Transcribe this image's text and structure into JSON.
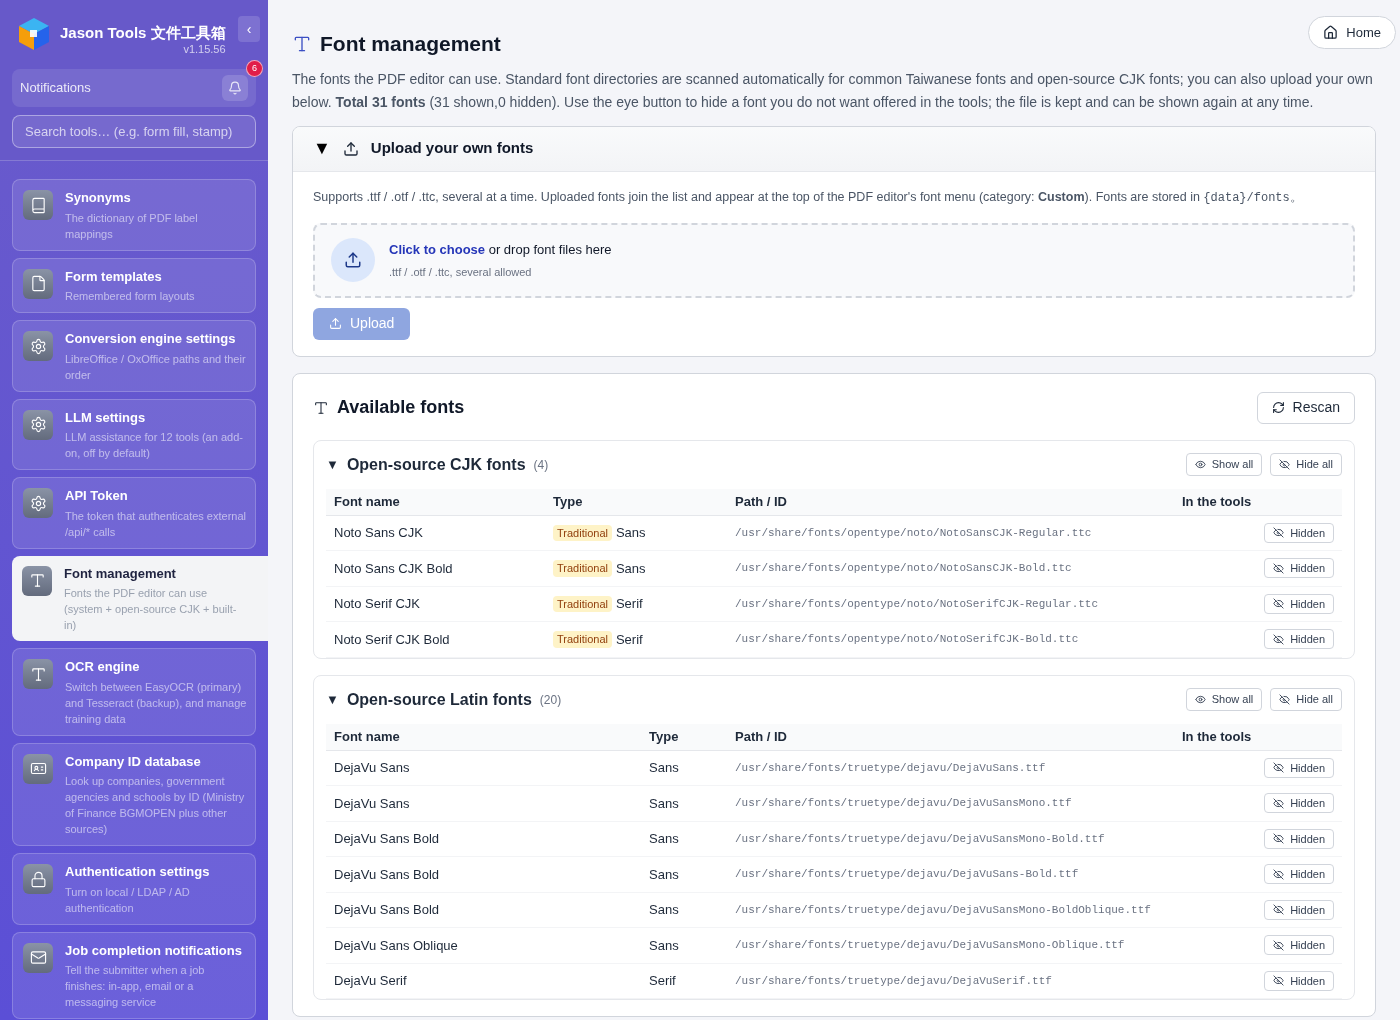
{
  "sidebar": {
    "app_title": "Jason Tools 文件工具箱",
    "version": "v1.15.56",
    "collapse": "‹",
    "notifications": {
      "label": "Notifications",
      "count": "6"
    },
    "search": {
      "placeholder": "Search tools… (e.g. form fill, stamp)"
    },
    "items": [
      {
        "kind": "book",
        "title": "Synonyms",
        "description": "The dictionary of PDF label mappings",
        "selected": false
      },
      {
        "kind": "file",
        "title": "Form templates",
        "description": "Remembered form layouts",
        "selected": false
      },
      {
        "kind": "gear",
        "title": "Conversion engine settings",
        "description": "LibreOffice / OxOffice paths and their order",
        "selected": false
      },
      {
        "kind": "gear",
        "title": "LLM settings",
        "description": "LLM assistance for 12 tools (an add-on, off by default)",
        "selected": false
      },
      {
        "kind": "gear",
        "title": "API Token",
        "description": "The token that authenticates external /api/* calls",
        "selected": false
      },
      {
        "kind": "type",
        "title": "Font management",
        "description": "Fonts the PDF editor can use (system + open-source CJK + built-in)",
        "selected": true
      },
      {
        "kind": "type",
        "title": "OCR engine",
        "description": "Switch between EasyOCR (primary) and Tesseract (backup), and manage training data",
        "selected": false
      },
      {
        "kind": "idcard",
        "title": "Company ID database",
        "description": "Look up companies, government agencies and schools by ID (Ministry of Finance BGMOPEN plus other sources)",
        "selected": false
      },
      {
        "kind": "lock",
        "title": "Authentication settings",
        "description": "Turn on local / LDAP / AD authentication",
        "selected": false
      },
      {
        "kind": "mail",
        "title": "Job completion notifications",
        "description": "Tell the submitter when a job finishes: in-app, email or a messaging service",
        "selected": false
      }
    ]
  },
  "page": {
    "title": "Font management",
    "home": "Home",
    "intro": "The fonts the PDF editor can use. Standard font directories are scanned automatically for common Taiwanese fonts and open-source CJK fonts; you can also upload your own below. **Total 31 fonts** (31 shown,0 hidden). Use the eye button to hide a font you do not want offered in the tools; the file is kept and can be shown again at any time."
  },
  "upload": {
    "expander": "▼",
    "title": "Upload your own fonts",
    "expanded": true,
    "note": "Supports .ttf / .otf / .ttc, several at a time. Uploaded fonts join the list and appear at the top of the PDF editor's font menu (category: **Custom**). Fonts are stored in ",
    "note_code": "{data}/fonts",
    "note_end": "。",
    "drop_link": "Click to choose",
    "drop_text": "or drop font files here",
    "drop_hint": ".ttf / .otf / .ttc, several allowed",
    "button": "Upload",
    "button_disabled": true
  },
  "available": {
    "title": "Available fonts",
    "rescan": "Rescan",
    "groups": [
      {
        "kind": "cjk",
        "expander": "▼",
        "title": "Open-source CJK fonts",
        "count": "(4)",
        "show_all": "Show all",
        "hide_all": "Hide all",
        "columns": [
          "Font name",
          "Type",
          "Path / ID",
          "In the tools"
        ],
        "rows": [
          {
            "name": "Noto Sans CJK",
            "tag": "Traditional",
            "type": "Sans",
            "path": "/usr/share/fonts/opentype/noto/NotoSansCJK-Regular.ttc",
            "status": "Hidden",
            "visible": false
          },
          {
            "name": "Noto Sans CJK Bold",
            "tag": "Traditional",
            "type": "Sans",
            "path": "/usr/share/fonts/opentype/noto/NotoSansCJK-Bold.ttc",
            "status": "Hidden",
            "visible": false
          },
          {
            "name": "Noto Serif CJK",
            "tag": "Traditional",
            "type": "Serif",
            "path": "/usr/share/fonts/opentype/noto/NotoSerifCJK-Regular.ttc",
            "status": "Hidden",
            "visible": false
          },
          {
            "name": "Noto Serif CJK Bold",
            "tag": "Traditional",
            "type": "Serif",
            "path": "/usr/share/fonts/opentype/noto/NotoSerifCJK-Bold.ttc",
            "status": "Hidden",
            "visible": false
          }
        ]
      },
      {
        "kind": "latin",
        "expander": "▼",
        "title": "Open-source Latin fonts",
        "count": "(20)",
        "show_all": "Show all",
        "hide_all": "Hide all",
        "columns": [
          "Font name",
          "Type",
          "Path / ID",
          "In the tools"
        ],
        "rows": [
          {
            "name": "DejaVu Sans",
            "type": "Sans",
            "path": "/usr/share/fonts/truetype/dejavu/DejaVuSans.ttf",
            "status": "Hidden",
            "visible": false
          },
          {
            "name": "DejaVu Sans",
            "type": "Sans",
            "path": "/usr/share/fonts/truetype/dejavu/DejaVuSansMono.ttf",
            "status": "Hidden",
            "visible": false
          },
          {
            "name": "DejaVu Sans Bold",
            "type": "Sans",
            "path": "/usr/share/fonts/truetype/dejavu/DejaVuSansMono-Bold.ttf",
            "status": "Hidden",
            "visible": false
          },
          {
            "name": "DejaVu Sans Bold",
            "type": "Sans",
            "path": "/usr/share/fonts/truetype/dejavu/DejaVuSans-Bold.ttf",
            "status": "Hidden",
            "visible": false
          },
          {
            "name": "DejaVu Sans Bold",
            "type": "Sans",
            "path": "/usr/share/fonts/truetype/dejavu/DejaVuSansMono-BoldOblique.ttf",
            "status": "Hidden",
            "visible": false
          },
          {
            "name": "DejaVu Sans Oblique",
            "type": "Sans",
            "path": "/usr/share/fonts/truetype/dejavu/DejaVuSansMono-Oblique.ttf",
            "status": "Hidden",
            "visible": false
          },
          {
            "name": "DejaVu Serif",
            "type": "Serif",
            "path": "/usr/share/fonts/truetype/dejavu/DejaVuSerif.ttf",
            "status": "Hidden",
            "visible": false
          }
        ]
      }
    ]
  }
}
